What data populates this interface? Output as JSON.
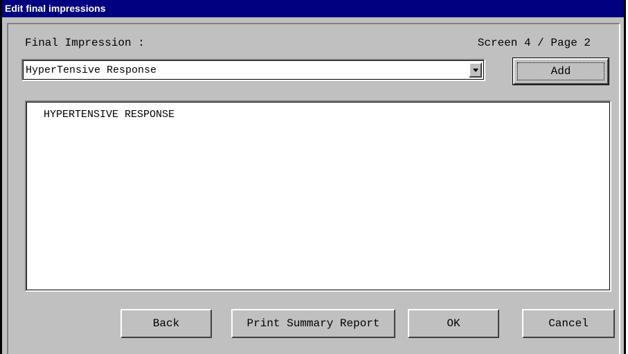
{
  "window": {
    "title": "Edit final impressions"
  },
  "header": {
    "final_impression_label": "Final Impression :",
    "screen_page": "Screen 4 / Page 2"
  },
  "combo": {
    "value": "HyperTensive Response"
  },
  "add_label": "Add",
  "list": {
    "items": [
      "HYPERTENSIVE RESPONSE"
    ]
  },
  "buttons": {
    "back": "Back",
    "print_summary": "Print Summary Report",
    "ok": "OK",
    "cancel": "Cancel"
  },
  "icons": {
    "dropdown": "chevron-down-icon"
  },
  "colors": {
    "titlebar": "#000080",
    "face": "#c0c0c0"
  }
}
